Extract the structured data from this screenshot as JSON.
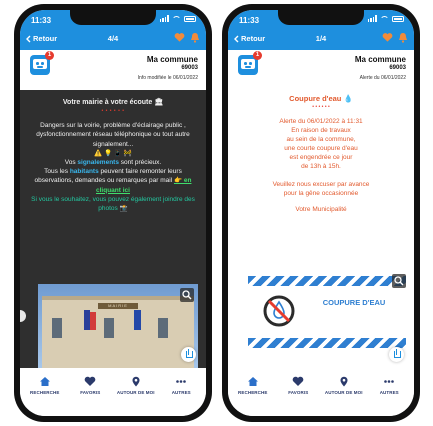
{
  "status_time": "11:33",
  "colors": {
    "brand_blue": "#1e8fde",
    "accent_red": "#e63b2e",
    "alert_orange": "#e25a2e",
    "dark_card": "#2f2f2f",
    "nav_text": "#2b3a6b"
  },
  "nav": {
    "back_label": "Retour"
  },
  "tabs": [
    {
      "label": "RECHERCHE",
      "icon": "home-icon"
    },
    {
      "label": "FAVORIS",
      "icon": "heart-icon"
    },
    {
      "label": "AUTOUR DE MOI",
      "icon": "map-pin-icon"
    },
    {
      "label": "AUTRES",
      "icon": "more-dots-icon"
    }
  ],
  "left": {
    "pager": "4/4",
    "commune": "Ma commune",
    "code": "69003",
    "meta": "Info modifiée le 06/01/2022",
    "title": "Votre mairie à votre écoute",
    "stars": "• • • • • •",
    "body1": "Dangers sur la voirie, problème d'éclairage public , dysfonctionnement réseau téléphonique ou tout autre signalement...",
    "emoji_line": "⚠️ 💡 📱 🚧",
    "p2_a": "Vos ",
    "p2_hl": "signalements",
    "p2_b": " sont précieux.",
    "p3_a": "Tous les ",
    "p3_hl": "habitants",
    "p3_b": " peuvent faire remonter leurs observations, demandes ou remarques par mail ",
    "p3_link": "👉 en cliquant ici",
    "p4": "Si vous le souhaitez, vous pouvez également joindre des photos 📸",
    "photo_sign": "MAIRIE"
  },
  "right": {
    "pager": "1/4",
    "commune": "Ma commune",
    "code": "69003",
    "meta": "Alerte du 06/01/2022",
    "title": "Coupure d'eau 💧",
    "stars": "• • • • • •",
    "l1": "Alerte du 06/01/2022 à 11:31",
    "l2": "En raison de travaux",
    "l3": "au sein de la commune,",
    "l4": "une courte coupure d'eau",
    "l5": "est engendrée ce jour",
    "l6": "de 13h à 15h.",
    "l7": "Veuillez nous excuser par avance",
    "l8": "pour la gêne occasionnée",
    "l9": "Votre Municipalité",
    "coupure_label": "COUPURE D'EAU"
  }
}
